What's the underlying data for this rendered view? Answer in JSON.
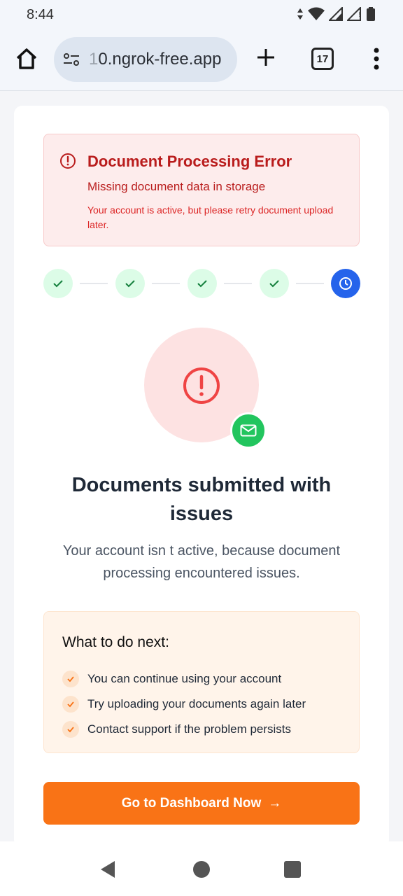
{
  "status_bar": {
    "time": "8:44"
  },
  "browser": {
    "url_faded": "1",
    "url_main": "0.ngrok-free.app",
    "tab_count": "17"
  },
  "error": {
    "title": "Document Processing Error",
    "subtitle": "Missing document data in storage",
    "detail": "Your account is active, but please retry document upload later."
  },
  "steps": [
    {
      "state": "done"
    },
    {
      "state": "done"
    },
    {
      "state": "done"
    },
    {
      "state": "done"
    },
    {
      "state": "active"
    }
  ],
  "main": {
    "title": "Documents submitted with issues",
    "description": "Your account isn t active, because document processing encountered issues."
  },
  "next_steps": {
    "title": "What to do next:",
    "items": [
      "You can continue using your account",
      "Try uploading your documents again later",
      "Contact support if the problem persists"
    ]
  },
  "cta": {
    "label": "Go to Dashboard Now",
    "arrow": "→"
  },
  "colors": {
    "error_text": "#b91c1c",
    "step_done_bg": "#dcfce7",
    "step_active": "#2563eb",
    "cta": "#f97316",
    "mail_badge": "#22c55e"
  },
  "icons": {
    "home": "home-icon",
    "site_settings": "tune-icon",
    "new_tab": "plus-icon",
    "menu": "more-vert-icon",
    "error": "alert-circle-icon",
    "step_done": "check-icon",
    "step_active": "clock-icon",
    "mail": "mail-icon",
    "list_check": "check-icon",
    "arrow": "arrow-right-icon"
  }
}
